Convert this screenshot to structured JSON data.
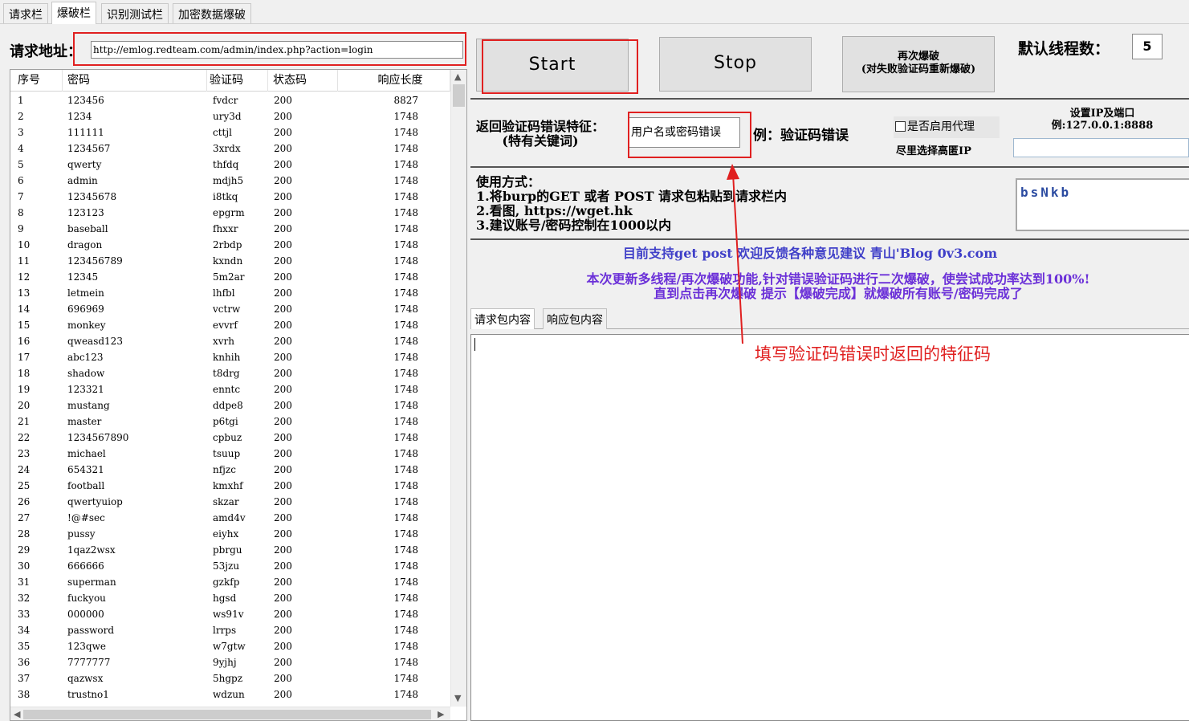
{
  "tabs": [
    "请求栏",
    "爆破栏",
    "识别测试栏",
    "加密数据爆破"
  ],
  "request": {
    "label": "请求地址：",
    "url": "http://emlog.redteam.com/admin/index.php?action=login"
  },
  "table": {
    "headers": [
      "序号",
      "密码",
      "验证码",
      "状态码",
      "响应长度"
    ],
    "rows": [
      [
        "1",
        "123456",
        "fvdcr",
        "200",
        "8827"
      ],
      [
        "2",
        "1234",
        "ury3d",
        "200",
        "1748"
      ],
      [
        "3",
        "111111",
        "cttjl",
        "200",
        "1748"
      ],
      [
        "4",
        "1234567",
        "3xrdx",
        "200",
        "1748"
      ],
      [
        "5",
        "qwerty",
        "thfdq",
        "200",
        "1748"
      ],
      [
        "6",
        "admin",
        "mdjh5",
        "200",
        "1748"
      ],
      [
        "7",
        "12345678",
        "i8tkq",
        "200",
        "1748"
      ],
      [
        "8",
        "123123",
        "epgrm",
        "200",
        "1748"
      ],
      [
        "9",
        "baseball",
        "fhxxr",
        "200",
        "1748"
      ],
      [
        "10",
        "dragon",
        "2rbdp",
        "200",
        "1748"
      ],
      [
        "11",
        "123456789",
        "kxndn",
        "200",
        "1748"
      ],
      [
        "12",
        "12345",
        "5m2ar",
        "200",
        "1748"
      ],
      [
        "13",
        "letmein",
        "lhfbl",
        "200",
        "1748"
      ],
      [
        "14",
        "696969",
        "vctrw",
        "200",
        "1748"
      ],
      [
        "15",
        "monkey",
        "evvrf",
        "200",
        "1748"
      ],
      [
        "16",
        "qweasd123",
        "xvrh",
        "200",
        "1748"
      ],
      [
        "17",
        "abc123",
        "knhih",
        "200",
        "1748"
      ],
      [
        "18",
        "shadow",
        "t8drg",
        "200",
        "1748"
      ],
      [
        "19",
        "123321",
        "enntc",
        "200",
        "1748"
      ],
      [
        "20",
        "mustang",
        "ddpe8",
        "200",
        "1748"
      ],
      [
        "21",
        "master",
        "p6tgi",
        "200",
        "1748"
      ],
      [
        "22",
        "1234567890",
        "cpbuz",
        "200",
        "1748"
      ],
      [
        "23",
        "michael",
        "tsuup",
        "200",
        "1748"
      ],
      [
        "24",
        "654321",
        "nfjzc",
        "200",
        "1748"
      ],
      [
        "25",
        "football",
        "kmxhf",
        "200",
        "1748"
      ],
      [
        "26",
        "qwertyuiop",
        "skzar",
        "200",
        "1748"
      ],
      [
        "27",
        "!@#sec",
        "amd4v",
        "200",
        "1748"
      ],
      [
        "28",
        "pussy",
        "eiyhx",
        "200",
        "1748"
      ],
      [
        "29",
        "1qaz2wsx",
        "pbrgu",
        "200",
        "1748"
      ],
      [
        "30",
        "666666",
        "53jzu",
        "200",
        "1748"
      ],
      [
        "31",
        "superman",
        "gzkfp",
        "200",
        "1748"
      ],
      [
        "32",
        "fuckyou",
        "hgsd",
        "200",
        "1748"
      ],
      [
        "33",
        "000000",
        "ws91v",
        "200",
        "1748"
      ],
      [
        "34",
        "password",
        "lrrps",
        "200",
        "1748"
      ],
      [
        "35",
        "123qwe",
        "w7gtw",
        "200",
        "1748"
      ],
      [
        "36",
        "7777777",
        "9yjhj",
        "200",
        "1748"
      ],
      [
        "37",
        "qazwsx",
        "5hgpz",
        "200",
        "1748"
      ],
      [
        "38",
        "trustno1",
        "wdzun",
        "200",
        "1748"
      ]
    ]
  },
  "buttons": {
    "start": "Start",
    "stop": "Stop",
    "retry_line1": "再次爆破",
    "retry_line2": "(对失败验证码重新爆破)"
  },
  "threads": {
    "label": "默认线程数：",
    "value": "5"
  },
  "captcha_error": {
    "label_line1": "返回验证码错误特征：",
    "label_line2": "(特有关键词)",
    "value": "用户名或密码错误",
    "example": "例：验证码错误"
  },
  "proxy": {
    "checkbox_label": "是否启用代理",
    "hint": "尽里选择高匿IP",
    "ip_label_line1": "设置IP及端口",
    "ip_label_line2": "例:127.0.0.1:8888",
    "ip_value": ""
  },
  "usage": {
    "title": "使用方式：",
    "line1": "1.将burp的GET 或者 POST 请求包粘贴到请求栏内",
    "line2": "2.看图, https://wget.hk",
    "line3": "3.建议账号/密码控制在1000以内"
  },
  "captcha_image_text": "bsNkb",
  "info": {
    "line1": "目前支持get post 欢迎反馈各种意见建议 青山'Blog 0v3.com",
    "line2": "本次更新多线程/再次爆破功能,针对错误验证码进行二次爆破，使尝试成功率达到100%!",
    "line3": "直到点击再次爆破 提示【爆破完成】就爆破所有账号/密码完成了"
  },
  "sub_tabs": [
    "请求包内容",
    "响应包内容"
  ],
  "annotation": "填写验证码错误时返回的特征码",
  "colors": {
    "highlight_red": "#e02020",
    "info_blue": "#3f3fc8",
    "info_purple": "#6b30d8"
  }
}
